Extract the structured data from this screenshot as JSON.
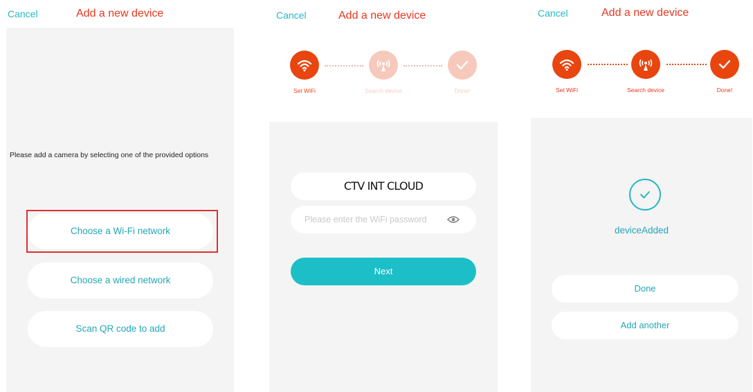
{
  "colors": {
    "accent": "#27b7c4",
    "title_red": "#e8361f",
    "step_orange": "#e8450f",
    "step_faded": "#f6c9bc",
    "highlight": "#e0302e"
  },
  "screen1": {
    "cancel": "Cancel",
    "title": "Add a new device",
    "hint": "Please add a camera by selecting one of the provided options",
    "options": [
      "Choose a Wi-Fi network",
      "Choose a wired network",
      "Scan QR code to add"
    ]
  },
  "screen2": {
    "cancel": "Cancel",
    "title": "Add a new device",
    "steps": [
      {
        "label": "Set WiFi",
        "icon": "wifi-icon",
        "state": "active"
      },
      {
        "label": "Search device",
        "icon": "antenna-icon",
        "state": "pending"
      },
      {
        "label": "Done!",
        "icon": "check-icon",
        "state": "pending"
      }
    ],
    "ssid": "CTV INT CLOUD",
    "password_placeholder": "Please enter the WiFi password",
    "next": "Next"
  },
  "screen3": {
    "cancel": "Cancel",
    "title": "Add a new device",
    "steps": [
      {
        "label": "Set WiFi",
        "icon": "wifi-icon",
        "state": "done"
      },
      {
        "label": "Search device",
        "icon": "antenna-icon",
        "state": "done"
      },
      {
        "label": "Done!",
        "icon": "check-icon",
        "state": "done"
      }
    ],
    "status": "deviceAdded",
    "done": "Done",
    "add_another": "Add another"
  }
}
